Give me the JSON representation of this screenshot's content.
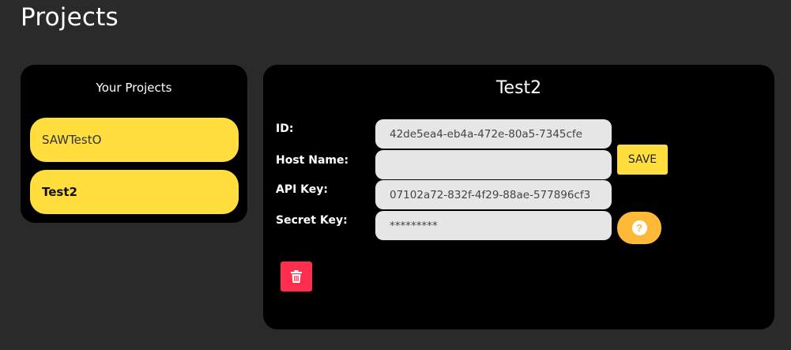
{
  "page": {
    "title": "Projects"
  },
  "sidebar": {
    "heading": "Your Projects",
    "items": [
      {
        "label": "SAWTestO",
        "selected": false
      },
      {
        "label": "Test2",
        "selected": true
      }
    ]
  },
  "detail": {
    "title": "Test2",
    "fields": {
      "id": {
        "label": "ID:",
        "value": "42de5ea4-eb4a-472e-80a5-7345cfe"
      },
      "host_name": {
        "label": "Host Name:",
        "value": ""
      },
      "api_key": {
        "label": "API Key:",
        "value": "07102a72-832f-4f29-88ae-577896cf3"
      },
      "secret_key": {
        "label": "Secret Key:",
        "value": "*********"
      }
    },
    "save_label": "SAVE",
    "help_glyph": "?",
    "icons": {
      "help": "question-circle-icon",
      "delete": "trash-icon"
    }
  },
  "colors": {
    "background": "#2a2a2a",
    "panel": "#000000",
    "accent_yellow": "#ffde3d",
    "help_orange": "#ffb938",
    "delete_red": "#ff2e4e",
    "input_bg": "#e6e6e6"
  }
}
